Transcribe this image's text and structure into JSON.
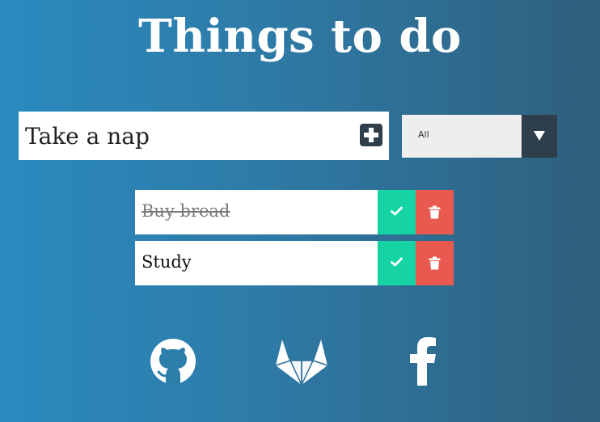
{
  "title": "Things to do",
  "input": {
    "value": "Take a nap",
    "placeholder": ""
  },
  "filter": {
    "selected": "All"
  },
  "todos": [
    {
      "text": "Buy bread",
      "completed": true
    },
    {
      "text": "Study",
      "completed": false
    }
  ],
  "social": [
    {
      "icon": "github-icon"
    },
    {
      "icon": "gitlab-icon"
    },
    {
      "icon": "facebook-icon"
    }
  ],
  "colors": {
    "background_start": "#2a8bbf",
    "background_end": "#2f5f7c",
    "dark": "#2f3e4b",
    "check": "#16d3a4",
    "trash": "#e85a4f"
  }
}
